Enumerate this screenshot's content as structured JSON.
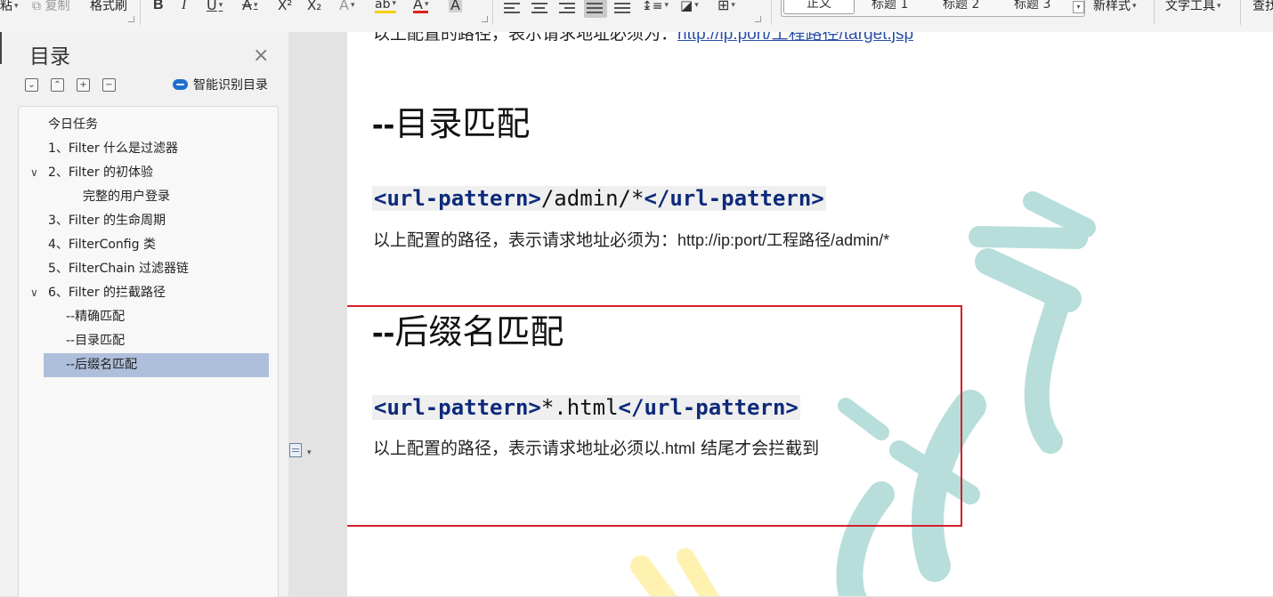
{
  "toolbar": {
    "paste_label": "粘",
    "copy_label": "复制",
    "format_painter_label": "格式刷",
    "bold_label": "B",
    "italic_label": "I",
    "underline_label": "U",
    "strike_label": "A",
    "superscript_label": "X²",
    "subscript_label": "X₂",
    "clear_label": "A",
    "highlight_label": "ab",
    "font_color_label": "A",
    "char_shade_label": "A",
    "styles": [
      "正文",
      "标题 1",
      "标题 2",
      "标题 3"
    ],
    "new_style_label": "新样式",
    "text_tools_label": "文字工具",
    "find_label": "查找"
  },
  "nav": {
    "title": "目录",
    "smart_toc_label": "智能识别目录",
    "items": [
      {
        "label": "今日任务"
      },
      {
        "label": "1、Filter 什么是过滤器"
      },
      {
        "label": "2、Filter 的初体验"
      },
      {
        "label": "完整的用户登录"
      },
      {
        "label": "3、Filter 的生命周期"
      },
      {
        "label": "4、FilterConfig 类"
      },
      {
        "label": "5、FilterChain 过滤器链"
      },
      {
        "label": "6、Filter 的拦截路径"
      },
      {
        "label": "--精确匹配"
      },
      {
        "label": "--目录匹配"
      },
      {
        "label": "--后缀名匹配"
      }
    ]
  },
  "doc": {
    "top_line_prefix": "以上配置的路径，表示请求地址必须为：",
    "top_line_link": "http://ip:port/工程路径/target.jsp",
    "heading1_dashes": "--",
    "heading1_text": "目录匹配",
    "code1": {
      "open": "<url-pattern>",
      "value": "/admin/*",
      "close": "</url-pattern>"
    },
    "para1_prefix": "以上配置的路径，表示请求地址必须为：",
    "para1_url": "http://ip:port/工程路径/admin/*",
    "heading2_dashes": "--",
    "heading2_text": "后缀名匹配",
    "code2": {
      "open": "<url-pattern>",
      "value": "*.html",
      "close": "</url-pattern>"
    },
    "para2_prefix": "以上配置的路径，表示请求地址必须以",
    "para2_ext": ".html",
    "para2_suffix": " 结尾才会拦截到"
  },
  "colors": {
    "highlight_box": "#d41f2c",
    "selected_toc": "#aebfdb",
    "code_tag": "#0d2a7a",
    "link": "#2a4fa8",
    "watermark_teal": "#9fd3ce",
    "watermark_yellow": "#fff0a8"
  }
}
